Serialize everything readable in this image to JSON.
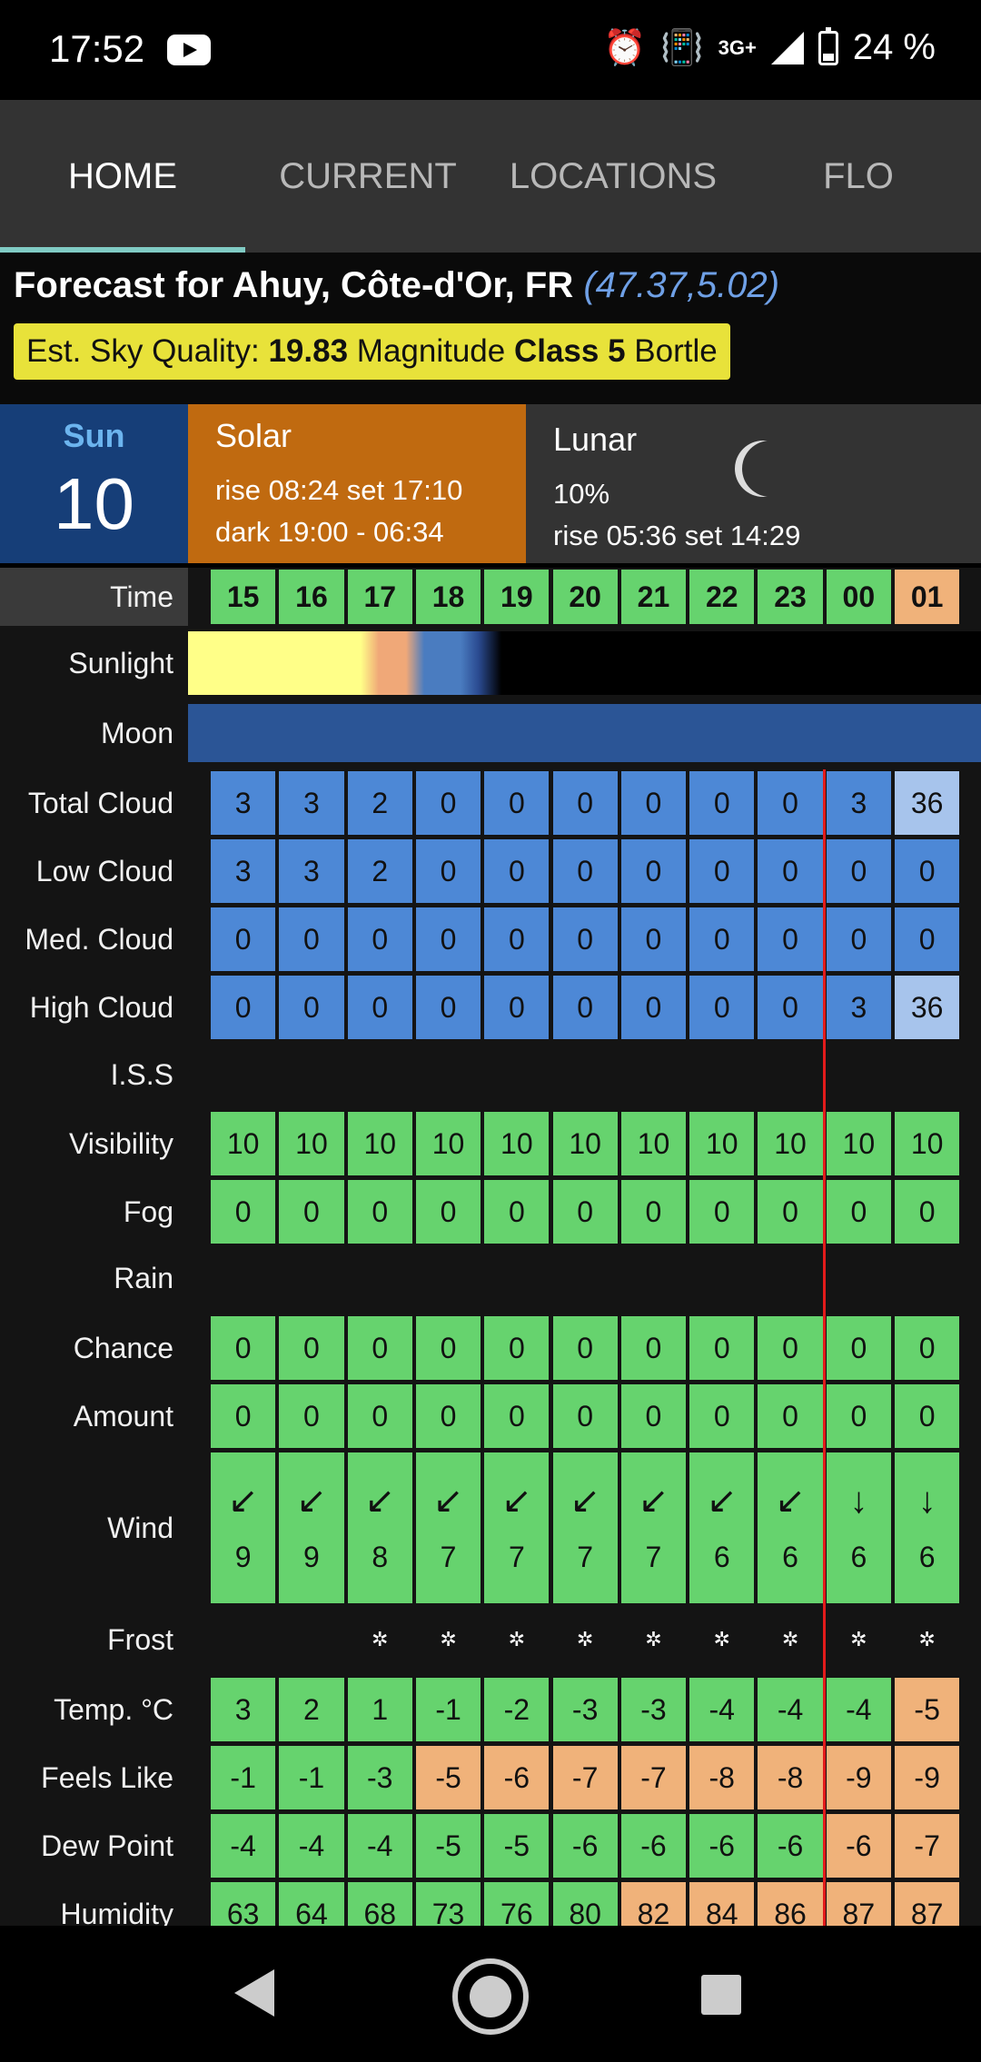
{
  "status_bar": {
    "time": "17:52",
    "network": "3G+",
    "battery": "24 %"
  },
  "tabs": [
    "HOME",
    "CURRENT",
    "LOCATIONS",
    "FLO"
  ],
  "header": {
    "title": "Forecast for Ahuy, Côte-d'Or, FR",
    "coords": "(47.37,5.02)",
    "sky_quality": {
      "prefix": "Est. Sky Quality: ",
      "value": "19.83",
      "mid": " Magnitude ",
      "class_label": "Class 5",
      "suffix": " Bortle"
    }
  },
  "day": {
    "name": "Sun",
    "number": "10"
  },
  "solar": {
    "title": "Solar",
    "rise_word": "rise ",
    "rise": "08:24",
    "set_word": " set ",
    "set": "17:10",
    "dark_word": "dark ",
    "dark": "19:00 - 06:34"
  },
  "lunar": {
    "title": "Lunar",
    "illumination": "10%",
    "rise_word": "rise ",
    "rise": "05:36",
    "set_word": " set ",
    "set": "14:29"
  },
  "colors": {
    "green": "#66d36e",
    "blue": "#4d88d6",
    "light_blue": "#a7c4ec",
    "orange": "#f0b27a",
    "red": "#e21b1b",
    "sky_quality_bg": "#e8e23a"
  },
  "row_labels": {
    "time": "Time",
    "sunlight": "Sunlight",
    "moon": "Moon",
    "total_cloud": "Total Cloud",
    "low_cloud": "Low Cloud",
    "med_cloud": "Med. Cloud",
    "high_cloud": "High Cloud",
    "iss": "I.S.S",
    "visibility": "Visibility",
    "fog": "Fog",
    "rain": "Rain",
    "chance": "Chance",
    "amount": "Amount",
    "wind": "Wind",
    "frost": "Frost",
    "temp": "Temp. °C",
    "feels_like": "Feels Like",
    "dew_point": "Dew Point",
    "humidity": "Humidity"
  },
  "hours": [
    "15",
    "16",
    "17",
    "18",
    "19",
    "20",
    "21",
    "22",
    "23",
    "00",
    "01"
  ],
  "rows": {
    "total_cloud": [
      "3",
      "3",
      "2",
      "0",
      "0",
      "0",
      "0",
      "0",
      "0",
      "3",
      "36"
    ],
    "low_cloud": [
      "3",
      "3",
      "2",
      "0",
      "0",
      "0",
      "0",
      "0",
      "0",
      "0",
      "0"
    ],
    "med_cloud": [
      "0",
      "0",
      "0",
      "0",
      "0",
      "0",
      "0",
      "0",
      "0",
      "0",
      "0"
    ],
    "high_cloud": [
      "0",
      "0",
      "0",
      "0",
      "0",
      "0",
      "0",
      "0",
      "0",
      "3",
      "36"
    ],
    "visibility": [
      "10",
      "10",
      "10",
      "10",
      "10",
      "10",
      "10",
      "10",
      "10",
      "10",
      "10"
    ],
    "fog": [
      "0",
      "0",
      "0",
      "0",
      "0",
      "0",
      "0",
      "0",
      "0",
      "0",
      "0"
    ],
    "chance": [
      "0",
      "0",
      "0",
      "0",
      "0",
      "0",
      "0",
      "0",
      "0",
      "0",
      "0"
    ],
    "amount": [
      "0",
      "0",
      "0",
      "0",
      "0",
      "0",
      "0",
      "0",
      "0",
      "0",
      "0"
    ],
    "wind_speed": [
      "9",
      "9",
      "8",
      "7",
      "7",
      "7",
      "7",
      "6",
      "6",
      "6",
      "6"
    ],
    "wind_arrow": [
      "↙",
      "↙",
      "↙",
      "↙",
      "↙",
      "↙",
      "↙",
      "↙",
      "↙",
      "↓",
      "↓"
    ],
    "frost_marks": [
      "",
      "",
      "✲",
      "✲",
      "✲",
      "✲",
      "✲",
      "✲",
      "✲",
      "✲",
      "✲"
    ],
    "temp": [
      "3",
      "2",
      "1",
      "-1",
      "-2",
      "-3",
      "-3",
      "-4",
      "-4",
      "-4",
      "-5"
    ],
    "feels_like": [
      "-1",
      "-1",
      "-3",
      "-5",
      "-6",
      "-7",
      "-7",
      "-8",
      "-8",
      "-9",
      "-9"
    ],
    "dew_point": [
      "-4",
      "-4",
      "-4",
      "-5",
      "-5",
      "-6",
      "-6",
      "-6",
      "-6",
      "-6",
      "-7"
    ],
    "humidity": [
      "63",
      "64",
      "68",
      "73",
      "76",
      "80",
      "82",
      "84",
      "86",
      "87",
      "87"
    ]
  },
  "cell_colors": {
    "time": [
      "green",
      "green",
      "green",
      "green",
      "green",
      "green",
      "green",
      "green",
      "green",
      "green",
      "orange"
    ],
    "total_cloud": [
      "blue",
      "blue",
      "blue",
      "blue",
      "blue",
      "blue",
      "blue",
      "blue",
      "blue",
      "blue",
      "light_blue"
    ],
    "low_cloud": [
      "blue",
      "blue",
      "blue",
      "blue",
      "blue",
      "blue",
      "blue",
      "blue",
      "blue",
      "blue",
      "blue"
    ],
    "med_cloud": [
      "blue",
      "blue",
      "blue",
      "blue",
      "blue",
      "blue",
      "blue",
      "blue",
      "blue",
      "blue",
      "blue"
    ],
    "high_cloud": [
      "blue",
      "blue",
      "blue",
      "blue",
      "blue",
      "blue",
      "blue",
      "blue",
      "blue",
      "blue",
      "light_blue"
    ],
    "visibility": [
      "green",
      "green",
      "green",
      "green",
      "green",
      "green",
      "green",
      "green",
      "green",
      "green",
      "green"
    ],
    "fog": [
      "green",
      "green",
      "green",
      "green",
      "green",
      "green",
      "green",
      "green",
      "green",
      "green",
      "green"
    ],
    "chance": [
      "green",
      "green",
      "green",
      "green",
      "green",
      "green",
      "green",
      "green",
      "green",
      "green",
      "green"
    ],
    "amount": [
      "green",
      "green",
      "green",
      "green",
      "green",
      "green",
      "green",
      "green",
      "green",
      "green",
      "green"
    ],
    "wind": [
      "green",
      "green",
      "green",
      "green",
      "green",
      "green",
      "green",
      "green",
      "green",
      "green",
      "green"
    ],
    "temp": [
      "green",
      "green",
      "green",
      "green",
      "green",
      "green",
      "green",
      "green",
      "green",
      "green",
      "orange"
    ],
    "feels_like": [
      "green",
      "green",
      "green",
      "orange",
      "orange",
      "orange",
      "orange",
      "orange",
      "orange",
      "orange",
      "orange"
    ],
    "dew_point": [
      "green",
      "green",
      "green",
      "green",
      "green",
      "green",
      "green",
      "green",
      "green",
      "orange",
      "orange"
    ],
    "humidity": [
      "green",
      "green",
      "green",
      "green",
      "green",
      "green",
      "orange",
      "orange",
      "orange",
      "orange",
      "orange"
    ]
  }
}
